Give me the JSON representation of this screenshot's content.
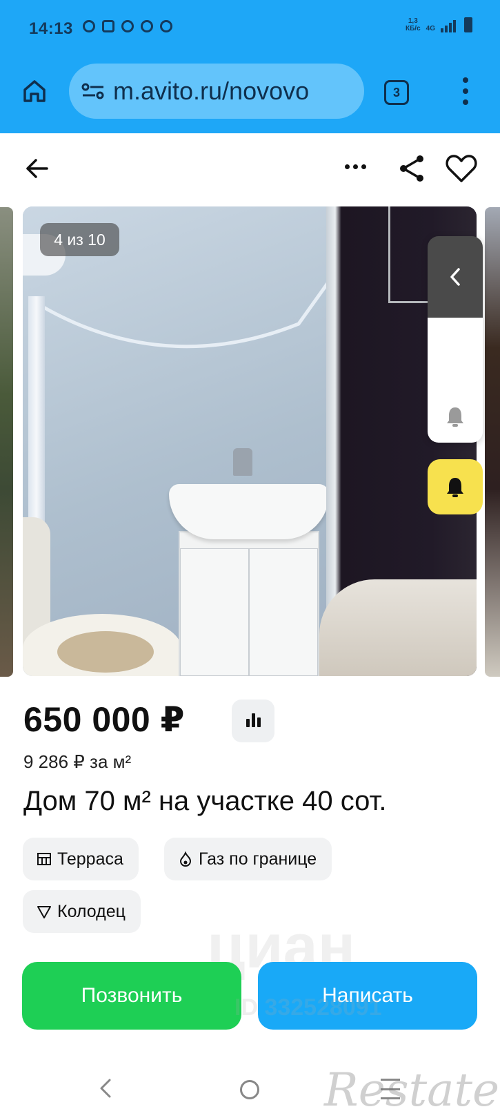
{
  "status_bar": {
    "time": "14:13",
    "net_speed_value": "1,3",
    "net_speed_unit": "КБ/с",
    "network": "4G"
  },
  "browser": {
    "url": "m.avito.ru/novovo",
    "tabs_count": "3",
    "accent_color": "#1ea7f7"
  },
  "gallery": {
    "counter": "4 из 10"
  },
  "listing": {
    "price": "650 000 ₽",
    "price_per_m2": "9 286 ₽ за м²",
    "title": "Дом 70 м² на участке 40 сот.",
    "tags": [
      {
        "label": "Терраса",
        "icon": "terrace-icon"
      },
      {
        "label": "Газ по границе",
        "icon": "gas-flame-icon"
      },
      {
        "label": "Колодец",
        "icon": "well-icon"
      }
    ]
  },
  "actions": {
    "call_label": "Позвонить",
    "call_color": "#1ecf55",
    "write_label": "Написать",
    "write_color": "#19a9f7"
  },
  "watermarks": {
    "center_text": "циан",
    "center_id": "ID 332528091",
    "corner_logo": "Restate"
  }
}
